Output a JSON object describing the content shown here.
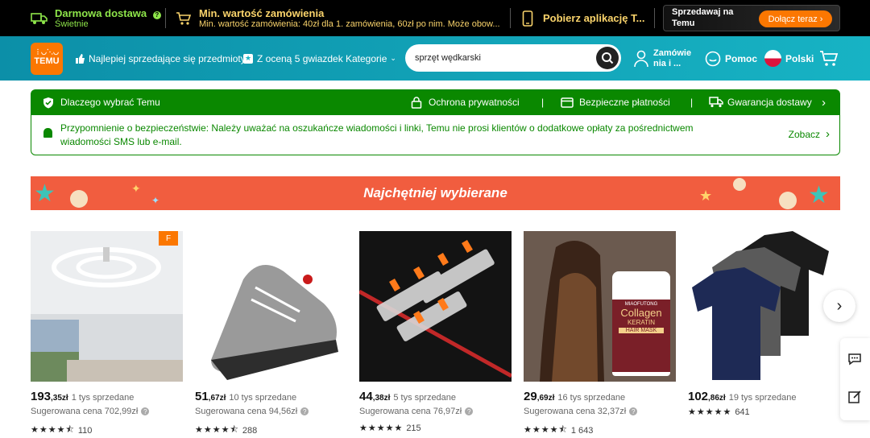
{
  "promo": {
    "free_shipping": {
      "title": "Darmowa dostawa",
      "subtitle": "Świetnie",
      "icon": "truck-icon"
    },
    "min_order": {
      "title": "Min. wartość zamówienia",
      "subtitle": "Min. wartość zamówienia: 40zł dla 1. zamówienia, 60zł po nim. Może obow...",
      "icon": "cart-icon"
    },
    "app": {
      "label": "Pobierz aplikację T...",
      "icon": "phone-icon"
    },
    "seller": {
      "label_line1": "Sprzedawaj na",
      "label_line2": "Temu",
      "button": "Dołącz teraz"
    }
  },
  "header": {
    "logo_top": "⋮◡⋱◡",
    "logo_text": "TEMU",
    "nav": [
      {
        "label": "Najlepiej sprzedające się przedmioty",
        "icon": "thumbs-up-icon"
      },
      {
        "label": "Z oceną 5 gwiazdek",
        "icon": "star-badge-icon"
      },
      {
        "label": "Kategorie",
        "icon": "chevron-down-icon"
      }
    ],
    "search_value": "sprzęt wędkarski",
    "orders_line1": "Zamówie",
    "orders_line2": "nia i ...",
    "help": "Pomoc",
    "language": "Polski"
  },
  "why_bar": {
    "title": "Dlaczego wybrać Temu",
    "items": [
      "Ochrona prywatności",
      "Bezpieczne płatności",
      "Gwarancja dostawy"
    ],
    "separator": "|"
  },
  "notice": {
    "line1": "Przypomnienie o bezpieczeństwie: Należy uważać na oszukańcze wiadomości i linki, Temu nie prosi klientów o dodatkowe opłaty za pośrednictwem",
    "line2": "wiadomości SMS lub e-mail.",
    "link": "Zobacz"
  },
  "banner": {
    "title": "Najchętniej wybierane"
  },
  "products": [
    {
      "price_main": "193",
      "price_dec": ",35zł",
      "sold": "1 tys sprzedane",
      "suggested": "Sugerowana cena 702,99zł",
      "rating": 4.5,
      "reviews": "110",
      "badge": "F"
    },
    {
      "price_main": "51",
      "price_dec": ",67zł",
      "sold": "10 tys sprzedane",
      "suggested": "Sugerowana cena 94,56zł",
      "rating": 4.5,
      "reviews": "288"
    },
    {
      "price_main": "44",
      "price_dec": ",38zł",
      "sold": "5 tys sprzedane",
      "suggested": "Sugerowana cena 76,97zł",
      "rating": 5,
      "reviews": "215"
    },
    {
      "price_main": "29",
      "price_dec": ",69zł",
      "sold": "16 tys sprzedane",
      "suggested": "Sugerowana cena 32,37zł",
      "rating": 4.5,
      "reviews": "1 643",
      "brand": "MIAOFUTONG",
      "label1": "Collagen",
      "label2": "KERATIN",
      "label3": "HAIR MASK"
    },
    {
      "price_main": "102",
      "price_dec": ",86zł",
      "sold": "19 tys sprzedane",
      "suggested": "",
      "rating": 5,
      "reviews": "641"
    }
  ],
  "colors": {
    "accent": "#fb7701",
    "green": "#0a8800",
    "banner": "#f15d3f",
    "header": "#17b3c4"
  }
}
